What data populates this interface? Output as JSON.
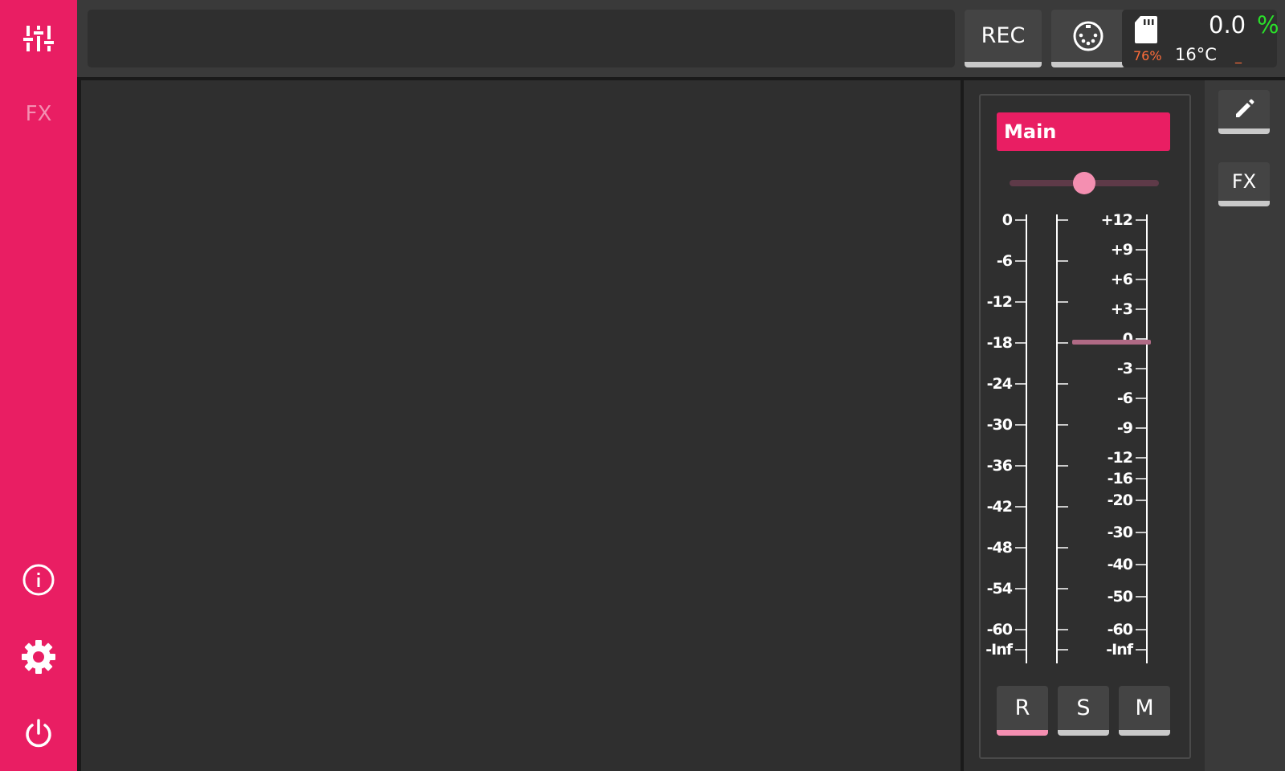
{
  "sidebar": {
    "fx_label": "FX",
    "icons": [
      "mixer-sliders-icon",
      "info-icon",
      "gear-icon",
      "power-icon"
    ]
  },
  "topbar": {
    "message": "",
    "rec_label": "REC",
    "midi_icon": "midi-din-icon",
    "status": {
      "sd_icon": "sd-card-icon",
      "sd_usage": "76%",
      "temperature": "16°C",
      "cpu_value": "0.0",
      "cpu_unit": "%",
      "indicator": "_"
    }
  },
  "channel": {
    "name": "Main",
    "pan_level": 0.5,
    "left_scale": [
      "0",
      "-6",
      "-12",
      "-18",
      "-24",
      "-30",
      "-36",
      "-42",
      "-48",
      "-54",
      "-60",
      "-Inf"
    ],
    "right_scale": [
      "+12",
      "+9",
      "+6",
      "+3",
      "0",
      "-3",
      "-6",
      "-9",
      "-12",
      "-16",
      "-20",
      "-30",
      "-40",
      "-50",
      "-60",
      "-Inf"
    ],
    "fader_value_db": 0,
    "buttons": {
      "record": "R",
      "solo": "S",
      "mute": "M"
    }
  },
  "right_column": {
    "edit_icon": "pencil-icon",
    "fx_label": "FX"
  },
  "colors": {
    "accent": "#e91e63",
    "accent_light": "#f48fb1",
    "background": "#2f2f2f",
    "cpu_percent": "#2ae02a",
    "warning": "#ff6d3a",
    "fader": "#b06a85"
  }
}
